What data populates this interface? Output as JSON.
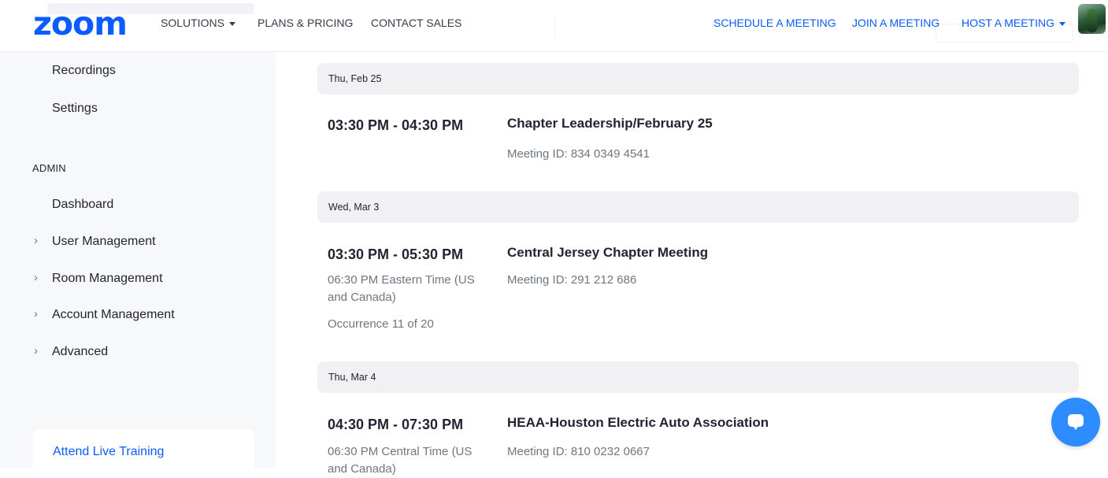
{
  "nav": {
    "logo": "zoom",
    "solutions": "SOLUTIONS",
    "plans": "PLANS & PRICING",
    "contact": "CONTACT SALES",
    "schedule": "SCHEDULE A MEETING",
    "join": "JOIN A MEETING",
    "host": "HOST A MEETING"
  },
  "sidebar": {
    "recordings": "Recordings",
    "settings": "Settings",
    "admin_section": "ADMIN",
    "dashboard": "Dashboard",
    "user_management": "User Management",
    "room_management": "Room Management",
    "account_management": "Account Management",
    "advanced": "Advanced",
    "chevron": "›",
    "attend_training": "Attend Live Training"
  },
  "meetings": [
    {
      "date": "Thu, Feb 25",
      "time": "03:30 PM - 04:30 PM",
      "title": "Chapter Leadership/February 25",
      "meeting_id": "Meeting ID: 834 0349 4541"
    },
    {
      "date": "Wed, Mar 3",
      "time": "03:30 PM - 05:30 PM",
      "local_time": "06:30 PM Eastern Time (US and Canada)",
      "occurrence": "Occurrence 11 of 20",
      "title": "Central Jersey Chapter Meeting",
      "meeting_id": "Meeting ID: 291 212 686"
    },
    {
      "date": "Thu, Mar 4",
      "time": "04:30 PM - 07:30 PM",
      "local_time": "06:30 PM Central Time (US and Canada)",
      "title": "HEAA-Houston Electric Auto Association",
      "meeting_id": "Meeting ID: 810 0232 0667"
    }
  ],
  "colors": {
    "brand": "#0b5cff",
    "chat_button": "#2d8cff",
    "sidebar_bg": "#f7f8fa",
    "date_header_bg": "#f1f1f4"
  },
  "icons": {
    "chat": "chat-bubble-icon",
    "avatar": "user-avatar"
  }
}
